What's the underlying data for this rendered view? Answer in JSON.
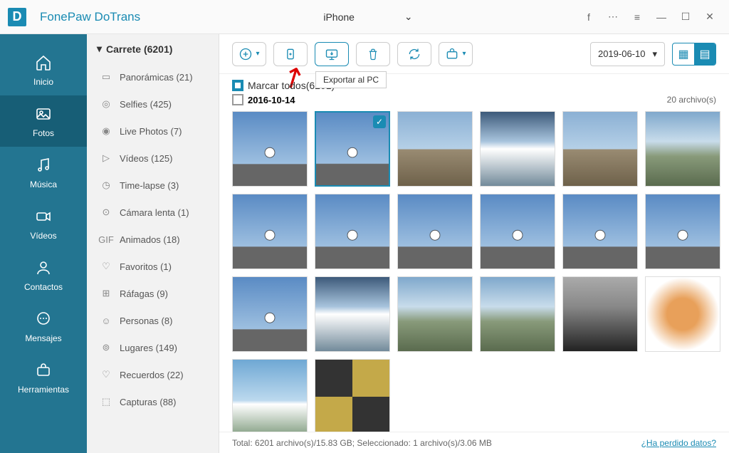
{
  "app": {
    "title": "FonePaw DoTrans"
  },
  "device": {
    "name": "iPhone"
  },
  "nav": {
    "inicio": "Inicio",
    "fotos": "Fotos",
    "musica": "Música",
    "videos": "Vídeos",
    "contactos": "Contactos",
    "mensajes": "Mensajes",
    "herramientas": "Herramientas"
  },
  "categories": {
    "header": "Carrete (6201)",
    "items": [
      {
        "icon": "panorama",
        "label": "Panorámicas (21)"
      },
      {
        "icon": "selfie",
        "label": "Selfies (425)"
      },
      {
        "icon": "livephoto",
        "label": "Live Photos (7)"
      },
      {
        "icon": "video",
        "label": "Vídeos (125)"
      },
      {
        "icon": "timelapse",
        "label": "Time-lapse (3)"
      },
      {
        "icon": "slomo",
        "label": "Cámara lenta (1)"
      },
      {
        "icon": "gif",
        "label": "Animados (18)"
      },
      {
        "icon": "heart",
        "label": "Favoritos (1)"
      },
      {
        "icon": "burst",
        "label": "Ráfagas (9)"
      },
      {
        "icon": "person",
        "label": "Personas (8)"
      },
      {
        "icon": "pin",
        "label": "Lugares (149)"
      },
      {
        "icon": "memory",
        "label": "Recuerdos (22)"
      },
      {
        "icon": "capture",
        "label": "Capturas (88)"
      }
    ]
  },
  "toolbar": {
    "tooltip_export": "Exportar al PC",
    "date_filter": "2019-06-10"
  },
  "content": {
    "select_all": "Marcar todos(6201)",
    "group_date": "2016-10-14",
    "group_count": "20 archivo(s)"
  },
  "footer": {
    "status": "Total: 6201 archivo(s)/15.83 GB; Seleccionado: 1 archivo(s)/3.06 MB",
    "link": "¿Ha perdido datos?"
  }
}
